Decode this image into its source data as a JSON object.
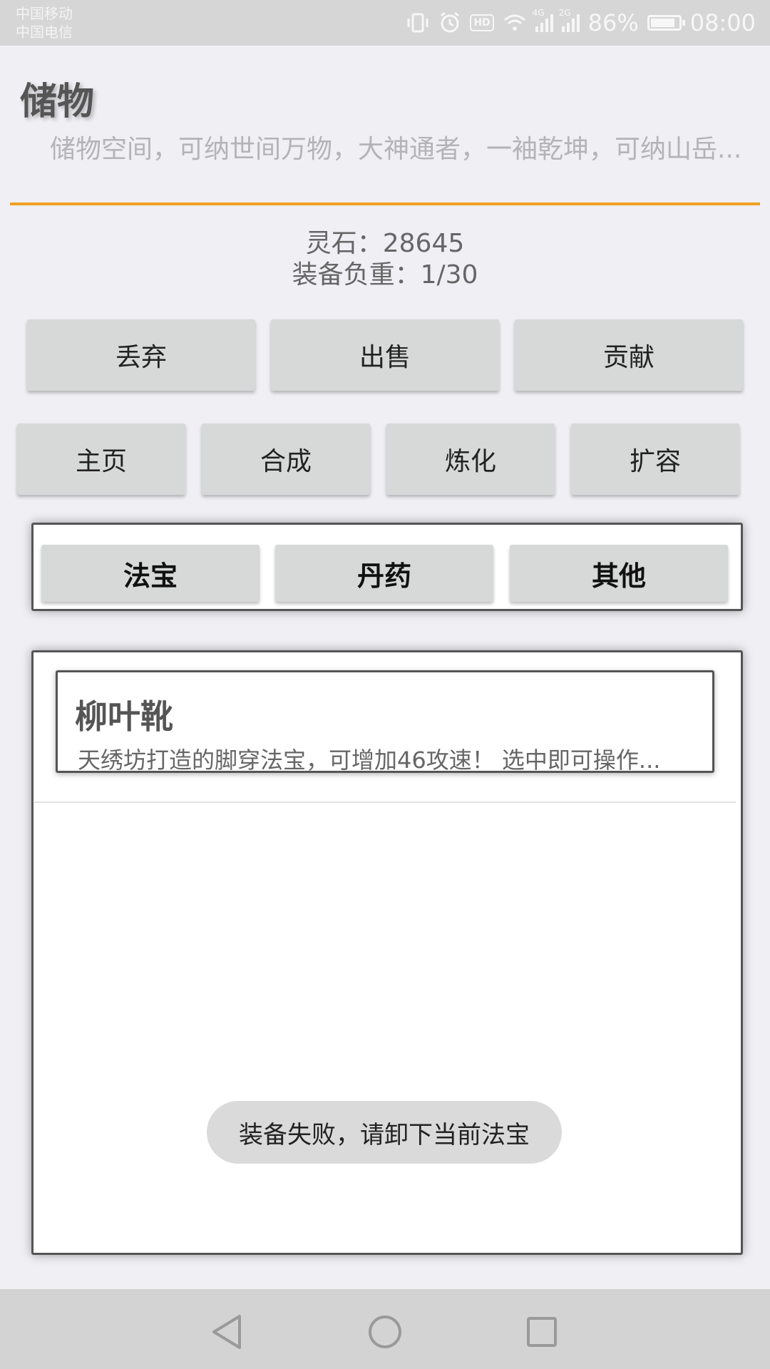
{
  "status_bar": {
    "carrier1": "中国移动",
    "carrier2": "中国电信",
    "net1": "4G",
    "net2": "2G",
    "battery_pct": "86%",
    "battery_level": 0.86,
    "time": "08:00",
    "hd": "HD"
  },
  "header": {
    "title": "储物",
    "description": "储物空间，可纳世间万物，大神通者，一袖乾坤，可纳山岳..."
  },
  "stats": {
    "spirit_stones": "灵石：28645",
    "equipment_load": "装备负重：1/30"
  },
  "actions": {
    "discard": "丢弃",
    "sell": "出售",
    "contribute": "贡献"
  },
  "nav": {
    "home": "主页",
    "synthesize": "合成",
    "refine": "炼化",
    "expand": "扩容"
  },
  "categories": {
    "treasure": "法宝",
    "pill": "丹药",
    "other": "其他"
  },
  "items": [
    {
      "name": "柳叶靴",
      "description": "天绣坊打造的脚穿法宝，可增加46攻速！ 选中即可操作..."
    }
  ],
  "toast": "装备失败，请卸下当前法宝",
  "colors": {
    "accent": "#f0a020",
    "button_bg": "#d7d8d8",
    "page_bg": "#efeff4"
  }
}
